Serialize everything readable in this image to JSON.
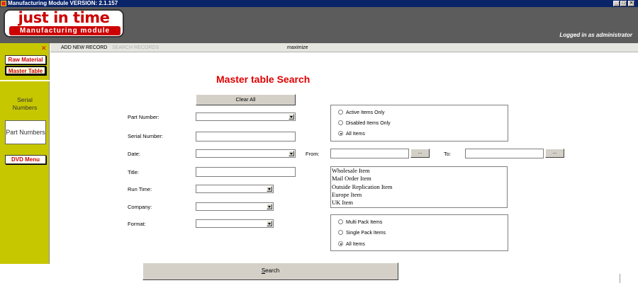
{
  "window": {
    "title": "Manufacturing Module VERSION: 2.1.157",
    "minimize_glyph": "_",
    "maximize_glyph": "□",
    "close_glyph": "✕"
  },
  "header": {
    "logo_main": "just in time",
    "logo_sub": "Manufacturing module",
    "logged_in": "Logged in as administrator"
  },
  "sidebar": {
    "close_glyph": "✕",
    "raw_material": "Raw Material",
    "master_table": "Master Table",
    "serial_numbers_line1": "Serial",
    "serial_numbers_line2": "Numbers",
    "part_numbers": "Part Numbers",
    "dvd_menu": "DVD Menu"
  },
  "toolbar": {
    "add_new_record": "ADD NEW RECORD",
    "search_records": "SEARCH RECORDS",
    "maximize": "maximize"
  },
  "page": {
    "title": "Master table Search",
    "clear_all": "Clear All",
    "search_prefix": "",
    "search_underlined": "S",
    "search_rest": "earch"
  },
  "form": {
    "part_number_label": "Part Number:",
    "serial_number_label": "Serial Number:",
    "date_label": "Date:",
    "title_label": "Title:",
    "run_time_label": "Run Time:",
    "company_label": "Company:",
    "format_label": "Format:",
    "from_label": "From:",
    "to_label": "To:",
    "browse_from": "...",
    "browse_to": "..."
  },
  "status_group": {
    "options": [
      "Active Items Only",
      "Disabled Items  Only",
      "All Items"
    ],
    "selected": "All Items"
  },
  "item_types": [
    "Wholesale Item",
    "Mail Order Item",
    "Outside Replication Item",
    "Europe Item",
    "UK Item"
  ],
  "pack_group": {
    "options": [
      "Multi Pack Items",
      "Single Pack Items",
      "All Items"
    ],
    "selected": "All Items"
  },
  "colors": {
    "title_bar": "#0a246a",
    "header": "#5c5c5c",
    "sidebar": "#c7c700",
    "accent_red": "#e00000"
  }
}
